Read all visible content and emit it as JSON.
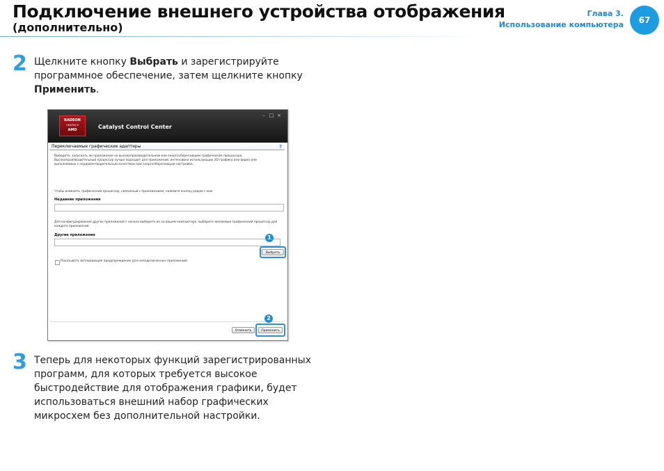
{
  "header": {
    "title": "Подключение внешнего устройства отображения",
    "subtitle": "(дополнительно)",
    "chapter_label": "Глава 3.",
    "chapter_name": "Использование компьютера",
    "page_number": "67"
  },
  "steps": [
    {
      "number": "2",
      "text_before": "Щелкните кнопку ",
      "bold1": "Выбрать",
      "text_middle": " и зарегистрируйте программное обеспечение, затем щелкните кнопку ",
      "bold2": "Применить",
      "text_after": "."
    },
    {
      "number": "3",
      "text": "Теперь для некоторых функций зарегистрированных программ, для которых требуется высокое быстродействие для отображения графики, будет использоваться внешний набор графических микросхем без дополнительной настройки."
    }
  ],
  "screenshot": {
    "logo_line1": "RADEON",
    "logo_line2": "GRAPHICS",
    "logo_line3": "AMD",
    "app_title": "Catalyst Control Center",
    "section_title": "Переключаемые графические адаптеры",
    "help_icon": "?",
    "description": "Выберите, запускать ли приложения на высокопроизводительном или энергосберегающем графическом процессоре. Высокопроизводительный процессор лучше подходит для приложений, интенсивно использующих 3D графику или видео или выполняемых с неудовлетворительным качеством при энергосберегающей настройке.",
    "change_hint": "Чтобы изменить графический процессор, связанный с приложением, нажмите кнопку рядом с ним.",
    "recent_apps_label": "Недавние приложения",
    "other_hint": "Для конфигурирования других приложений с начала выберите их на вашем компьютере, выберите желаемый графический процессор для каждого приложения.",
    "other_apps_label": "Другие приложения",
    "choose_button": "Выбрать",
    "warning_checkbox": "Показывать всплывающее предупреждение для неподключенных приложений",
    "cancel_button": "Отменить",
    "apply_button": "Применить",
    "marker1": "1",
    "marker2": "2",
    "accent_color": "#1d9ce0"
  }
}
